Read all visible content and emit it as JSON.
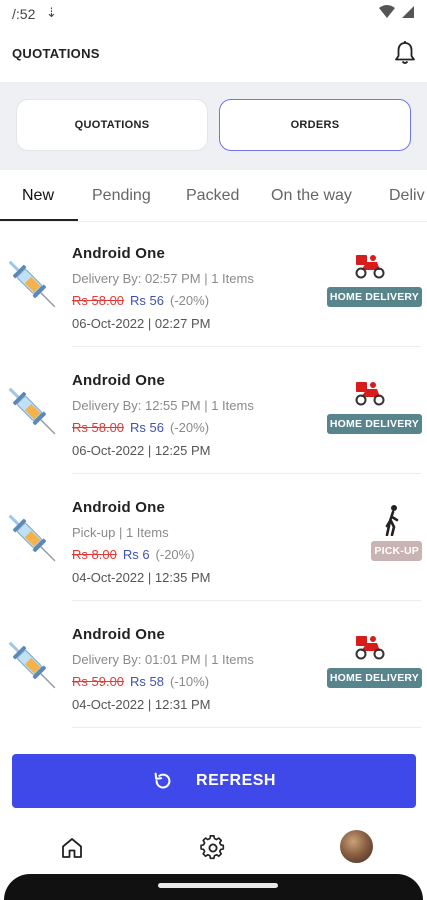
{
  "status_bar": {
    "time": "/:52",
    "download_icon": "download-arrow-icon"
  },
  "header": {
    "title": "QUOTATIONS",
    "bell_icon": "bell-icon"
  },
  "segments": {
    "quotations": "QUOTATIONS",
    "orders": "ORDERS",
    "selected": "orders"
  },
  "tabs": [
    "New",
    "Pending",
    "Packed",
    "On the way",
    "Deliv"
  ],
  "active_tab": "New",
  "orders": [
    {
      "name": "Android One",
      "info": "Delivery By: 02:57 PM | 1 Items",
      "old_price": "Rs 58.00",
      "new_price": "Rs 56",
      "discount": "(-20%)",
      "date": "06-Oct-2022 | 02:27 PM",
      "badge": "HOME DELIVERY",
      "type": "home"
    },
    {
      "name": "Android One",
      "info": "Delivery By: 12:55 PM | 1 Items",
      "old_price": "Rs 58.00",
      "new_price": "Rs 56",
      "discount": "(-20%)",
      "date": "06-Oct-2022 | 12:25 PM",
      "badge": "HOME DELIVERY",
      "type": "home"
    },
    {
      "name": "Android One",
      "info": "Pick-up | 1 Items",
      "old_price": "Rs 8.00",
      "new_price": "Rs 6",
      "discount": "(-20%)",
      "date": "04-Oct-2022 | 12:35 PM",
      "badge": "PICK-UP",
      "type": "pickup"
    },
    {
      "name": "Android One",
      "info": "Delivery By: 01:01 PM | 1 Items",
      "old_price": "Rs 59.00",
      "new_price": "Rs 58",
      "discount": "(-10%)",
      "date": "04-Oct-2022 | 12:31 PM",
      "badge": "HOME DELIVERY",
      "type": "home"
    }
  ],
  "refresh": {
    "label": "REFRESH",
    "icon": "refresh-icon"
  },
  "bottom_nav": {
    "home_icon": "home-icon",
    "settings_icon": "gear-icon",
    "avatar": "avatar"
  },
  "colors": {
    "accent": "#3f49ea",
    "home_badge": "#58858c",
    "pickup_badge": "#c9b3b3",
    "old_price": "#e53935",
    "new_price": "#3f51b5"
  }
}
